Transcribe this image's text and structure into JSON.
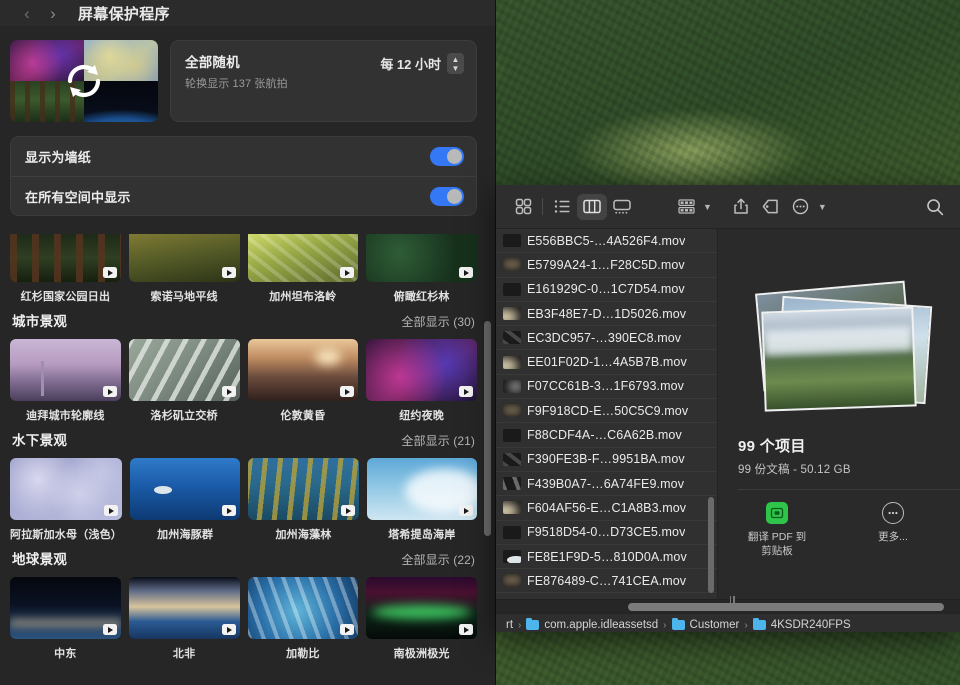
{
  "settings": {
    "title": "屏幕保护程序",
    "nav": {
      "back": "‹",
      "forward": "›"
    },
    "hero": {
      "title": "全部随机",
      "subtitle": "轮换显示 137 张航拍",
      "interval": "每 12 小时"
    },
    "toggles": [
      {
        "label": "显示为墙纸",
        "on": true
      },
      {
        "label": "在所有空间中显示",
        "on": true
      }
    ],
    "sections": [
      {
        "title": "",
        "show_all": "",
        "clipped": true,
        "items": [
          {
            "caption": "红杉国家公园日出",
            "art": "a-redwood"
          },
          {
            "caption": "索诺马地平线",
            "art": "a-sonoma"
          },
          {
            "caption": "加州坦布洛岭",
            "art": "a-tamb"
          },
          {
            "caption": "俯瞰红杉林",
            "art": "a-aerial"
          }
        ]
      },
      {
        "title": "城市景观",
        "show_all": "全部显示 (30)",
        "clipped": false,
        "items": [
          {
            "caption": "迪拜城市轮廓线",
            "art": "a-dubai"
          },
          {
            "caption": "洛杉矶立交桥",
            "art": "a-lax"
          },
          {
            "caption": "伦敦黄昏",
            "art": "a-london"
          },
          {
            "caption": "纽约夜晚",
            "art": "a-nyc"
          }
        ]
      },
      {
        "title": "水下景观",
        "show_all": "全部显示 (21)",
        "clipped": false,
        "items": [
          {
            "caption": "阿拉斯加水母（浅色）",
            "art": "a-jelly"
          },
          {
            "caption": "加州海豚群",
            "art": "a-dolphin"
          },
          {
            "caption": "加州海藻林",
            "art": "a-kelp"
          },
          {
            "caption": "塔希提岛海岸",
            "art": "a-tahiti"
          }
        ]
      },
      {
        "title": "地球景观",
        "show_all": "全部显示 (22)",
        "clipped": false,
        "items": [
          {
            "caption": "中东",
            "art": "a-mideast"
          },
          {
            "caption": "北非",
            "art": "a-nafrica"
          },
          {
            "caption": "加勒比",
            "art": "a-carib"
          },
          {
            "caption": "南极洲极光",
            "art": "a-aurora"
          }
        ]
      }
    ]
  },
  "finder": {
    "toolbar": {
      "view_icon": "icon-view-icon",
      "view_list": "list-view-icon",
      "view_column": "column-view-icon",
      "view_gallery": "gallery-view-icon",
      "group_by": "group-by-icon",
      "share": "share-icon",
      "tag": "tag-icon",
      "more": "more-ellipsis-icon",
      "search": "search-icon",
      "ellipsis_glyph": "•••"
    },
    "files": [
      {
        "name": "E556BBC5-…4A526F4.mov",
        "art": "a-sonoma"
      },
      {
        "name": "E5799A24-1…F28C5D.mov",
        "art": "a-mideast"
      },
      {
        "name": "E161929C-0…1C7D54.mov",
        "art": "a-aerial"
      },
      {
        "name": "EB3F48E7-D…1D5026.mov",
        "art": "a-london"
      },
      {
        "name": "EC3DC957-…390EC8.mov",
        "art": "a-tamb"
      },
      {
        "name": "EE01F02D-1…4A5B7B.mov",
        "art": "a-london"
      },
      {
        "name": "F07CC61B-3…1F6793.mov",
        "art": "a-tahiti"
      },
      {
        "name": "F9F918CD-E…50C5C9.mov",
        "art": "a-mideast"
      },
      {
        "name": "F88CDF4A-…C6A62B.mov",
        "art": "a-nyc"
      },
      {
        "name": "F390FE3B-F…9951BA.mov",
        "art": "a-tamb"
      },
      {
        "name": "F439B0A7-…6A74FE9.mov",
        "art": "a-carib"
      },
      {
        "name": "F604AF56-E…C1A8B3.mov",
        "art": "a-london"
      },
      {
        "name": "F9518D54-0…D73CE5.mov",
        "art": "a-sonoma"
      },
      {
        "name": "FE8E1F9D-5…810D0A.mov",
        "art": "a-dolphin"
      },
      {
        "name": "FE876489-C…741CEA.mov",
        "art": "a-mideast"
      }
    ],
    "info": {
      "count": "99 个项目",
      "detail": "99 份文稿 - 50.12 GB"
    },
    "actions": [
      {
        "label": "翻译 PDF 到\n剪贴板",
        "icon": "pdf-translate-icon"
      },
      {
        "label": "更多...",
        "icon": "more-ellipsis-icon"
      }
    ],
    "breadcrumb": [
      {
        "text": "rt",
        "folder": false
      },
      {
        "text": "com.apple.idleassetsd",
        "folder": true
      },
      {
        "text": "Customer",
        "folder": true
      },
      {
        "text": "4KSDR240FPS",
        "folder": true
      }
    ],
    "separator": "›"
  },
  "colors": {
    "accent": "#3478f6",
    "window_bg": "#262626",
    "finder_bg": "#2a2a2a",
    "folder_blue": "#4db4ec",
    "action_green": "#2fc44a"
  }
}
